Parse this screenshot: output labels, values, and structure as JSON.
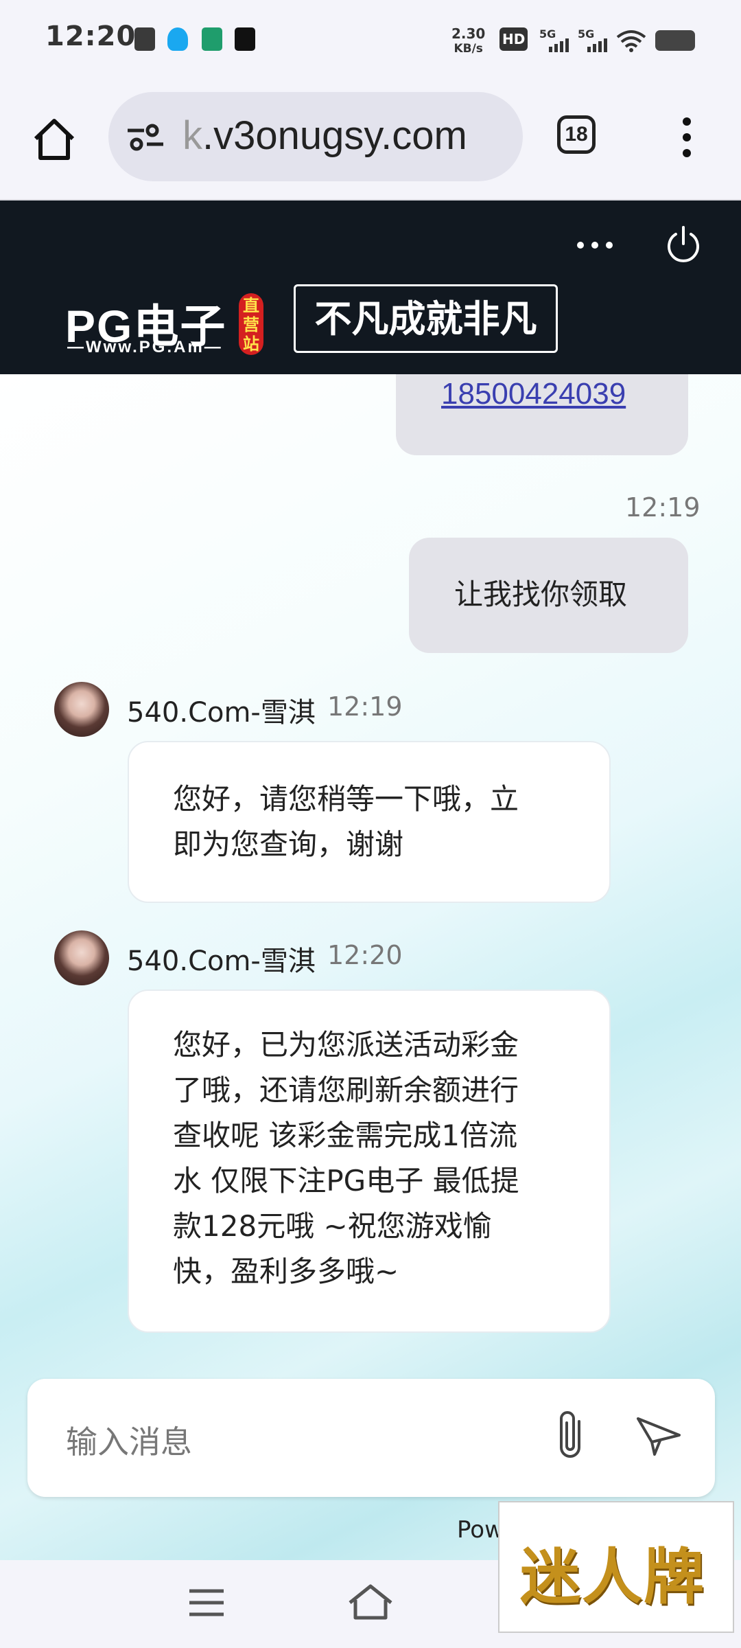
{
  "status_bar": {
    "time": "12:20",
    "net_speed_value": "2.30",
    "net_speed_unit": "KB/s",
    "hd_label": "HD",
    "sim1_label": "5G",
    "sim2_label": "5G"
  },
  "browser": {
    "url_faded": "k",
    "url_main": ".v3onugsy.com",
    "tab_count": "18"
  },
  "site_header": {
    "logo_text": "PG电子",
    "logo_sub": "—Www.PG.Am—",
    "badge_text": "直营站",
    "slogan": "不凡成就非凡"
  },
  "chat": {
    "messages": [
      {
        "side": "right",
        "text": "18500424039",
        "is_link": true
      },
      {
        "side": "right",
        "time": "12:19",
        "text": "让我找你领取"
      },
      {
        "side": "left",
        "sender": "540.Com-雪淇",
        "time": "12:19",
        "lines": [
          "您好，请您稍等一下哦，立",
          "即为您查询，谢谢"
        ]
      },
      {
        "side": "left",
        "sender": "540.Com-雪淇",
        "time": "12:20",
        "lines": [
          "您好，已为您派送活动彩金",
          "了哦，还请您刷新余额进行",
          "查收呢 该彩金需完成1倍流",
          "水 仅限下注PG电子 最低提",
          "款128元哦 ~祝您游戏愉",
          "快，盈利多多哦~"
        ]
      }
    ]
  },
  "input": {
    "placeholder": "输入消息"
  },
  "footer": {
    "powered": "Pow"
  },
  "watermark": {
    "text": "迷人牌"
  },
  "colors": {
    "header_bg": "#111820",
    "link": "#3a3fb0",
    "watermark_gold": "#c4901c"
  }
}
